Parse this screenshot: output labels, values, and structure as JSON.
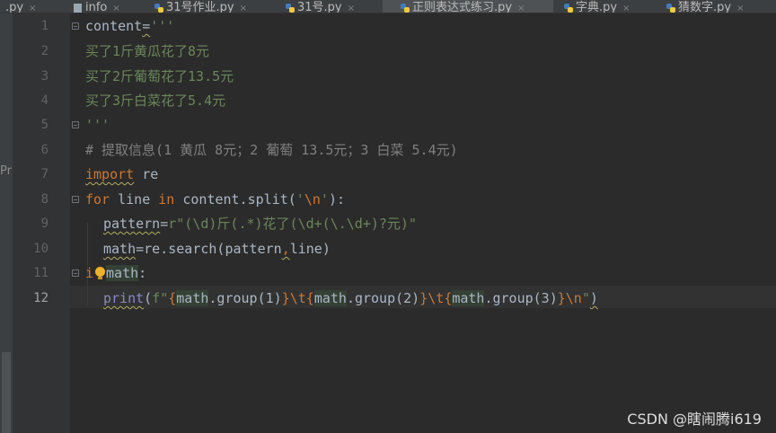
{
  "tabs": [
    {
      "label": ".py",
      "has_close": true,
      "icon": "none"
    },
    {
      "label": "info",
      "has_close": true,
      "icon": "file-icon"
    },
    {
      "label": "31号作业.py",
      "has_close": true,
      "icon": "python-file-icon"
    },
    {
      "label": "31号.py",
      "has_close": true,
      "icon": "python-file-icon"
    },
    {
      "label": "正则表达式练习.py",
      "has_close": true,
      "icon": "python-file-icon",
      "active": true
    },
    {
      "label": "字典.py",
      "has_close": true,
      "icon": "python-file-icon"
    },
    {
      "label": "猜数字.py",
      "has_close": true,
      "icon": "python-file-icon"
    }
  ],
  "tab_close_glyph": "×",
  "left_strip_text": "Pr",
  "line_numbers": [
    "1",
    "2",
    "3",
    "4",
    "5",
    "6",
    "7",
    "8",
    "9",
    "10",
    "11",
    "12"
  ],
  "current_line": "12",
  "code": {
    "l1_a": "content",
    "l1_b": "=",
    "l1_c": "'''",
    "l2": "买了1斤黄瓜花了8元",
    "l3": "买了2斤葡萄花了13.5元",
    "l4": "买了3斤白菜花了5.4元",
    "l5": "'''",
    "l6": "# 提取信息(1 黄瓜 8元；2 葡萄 13.5元；3 白菜 5.4元)",
    "l7_kw": "import",
    "l7_rest": " re",
    "l8_kw1": "for",
    "l8_a": " line ",
    "l8_kw2": "in",
    "l8_b": " content.split(",
    "l8_s1": "'",
    "l8_esc": "\\n",
    "l8_s2": "'",
    "l8_c": "):",
    "l9_a": "pattern",
    "l9_b": "=",
    "l9_s": "r\"(\\d)斤(.*)花了(\\d+(\\.\\d+)?元)\"",
    "l10_a": "math",
    "l10_b": "=re.search(pattern",
    "l10_c": ",",
    "l10_d": "line)",
    "l11_a": "i",
    "l11_b": "math",
    "l11_c": ":",
    "l12_print": "print",
    "l12_open": "(",
    "l12_f": "f\"",
    "l12_b1": "{",
    "l12_v1": "math",
    "l12_e1": ".group(1)",
    "l12_b2": "}",
    "l12_t1": "\\t",
    "l12_b3": "{",
    "l12_v2": "math",
    "l12_e2": ".group(2)",
    "l12_b4": "}",
    "l12_t2": "\\t",
    "l12_b5": "{",
    "l12_v3": "math",
    "l12_e3": ".group(3)",
    "l12_b6": "}",
    "l12_n": "\\n",
    "l12_q": "\"",
    "l12_close": ")"
  },
  "watermark": "CSDN @瞎闹腾i619",
  "colors": {
    "background": "#2b2b2b",
    "keyword": "#cc7832",
    "string": "#6a8759",
    "comment": "#808080",
    "builtin": "#8888c6",
    "default_text": "#a9b7c6"
  }
}
